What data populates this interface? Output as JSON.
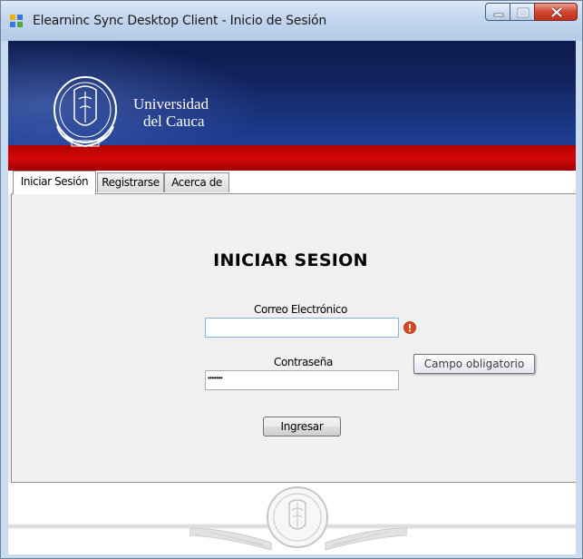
{
  "window": {
    "title": "Elearninc Sync Desktop Client - Inicio de Sesión",
    "controls": [
      "minimize",
      "maximize",
      "close"
    ]
  },
  "banner": {
    "university_line1": "Universidad",
    "university_line2": "del Cauca",
    "colors": {
      "blue": "#1c3a8c",
      "red": "#c80000"
    }
  },
  "tabs": [
    {
      "label": "Iniciar Sesión",
      "active": true
    },
    {
      "label": "Registrarse",
      "active": false
    },
    {
      "label": "Acerca de",
      "active": false
    }
  ],
  "login": {
    "title": "INICIAR SESION",
    "email_label": "Correo Electrónico",
    "email_value": "",
    "password_label": "Contraseña",
    "password_value": "•••••••",
    "submit_label": "Ingresar",
    "error_tooltip": "Campo obligatorio"
  }
}
